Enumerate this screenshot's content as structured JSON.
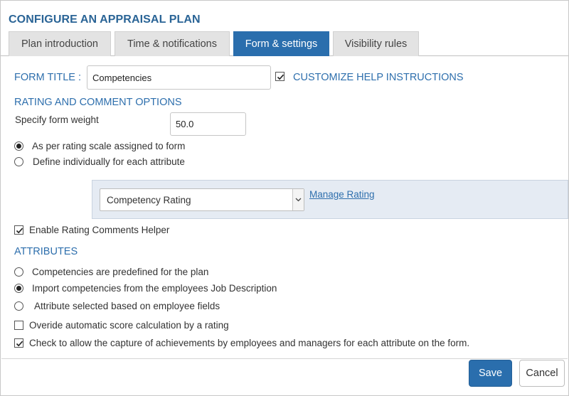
{
  "page_title": "CONFIGURE AN APPRAISAL PLAN",
  "tabs": [
    {
      "label": "Plan introduction",
      "active": false
    },
    {
      "label": "Time & notifications",
      "active": false
    },
    {
      "label": "Form & settings",
      "active": true
    },
    {
      "label": "Visibility rules",
      "active": false
    }
  ],
  "form_title": {
    "label": "FORM TITLE :",
    "value": "Competencies"
  },
  "customize_help": {
    "label": "CUSTOMIZE HELP INSTRUCTIONS",
    "checked": true
  },
  "rating_section": {
    "heading": "RATING AND COMMENT OPTIONS",
    "weight_label": "Specify form weight",
    "weight_value": "50.0",
    "options": [
      {
        "label": "As per rating scale assigned to form",
        "selected": true
      },
      {
        "label": "Define individually for each attribute",
        "selected": false
      }
    ],
    "rating_select": "Competency Rating",
    "manage_link": "Manage Rating",
    "comments_helper": {
      "label": "Enable Rating Comments Helper",
      "checked": true
    }
  },
  "attributes": {
    "heading": "ATTRIBUTES",
    "options": [
      {
        "label": "Competencies are predefined for the plan",
        "selected": false
      },
      {
        "label": "Import competencies from the employees Job Description",
        "selected": true
      },
      {
        "label": " Attribute selected based on employee fields",
        "selected": false
      }
    ],
    "override": {
      "label": "Overide automatic score calculation by a rating",
      "checked": false
    },
    "achievements": {
      "label": "Check to allow the capture of achievements by employees and managers for each attribute on the form.",
      "checked": true
    }
  },
  "footer": {
    "save_label": "Save",
    "cancel_label": "Cancel"
  },
  "colors": {
    "accent": "#2a6ead",
    "heading": "#2a6496",
    "panel": "#e5ebf3"
  }
}
